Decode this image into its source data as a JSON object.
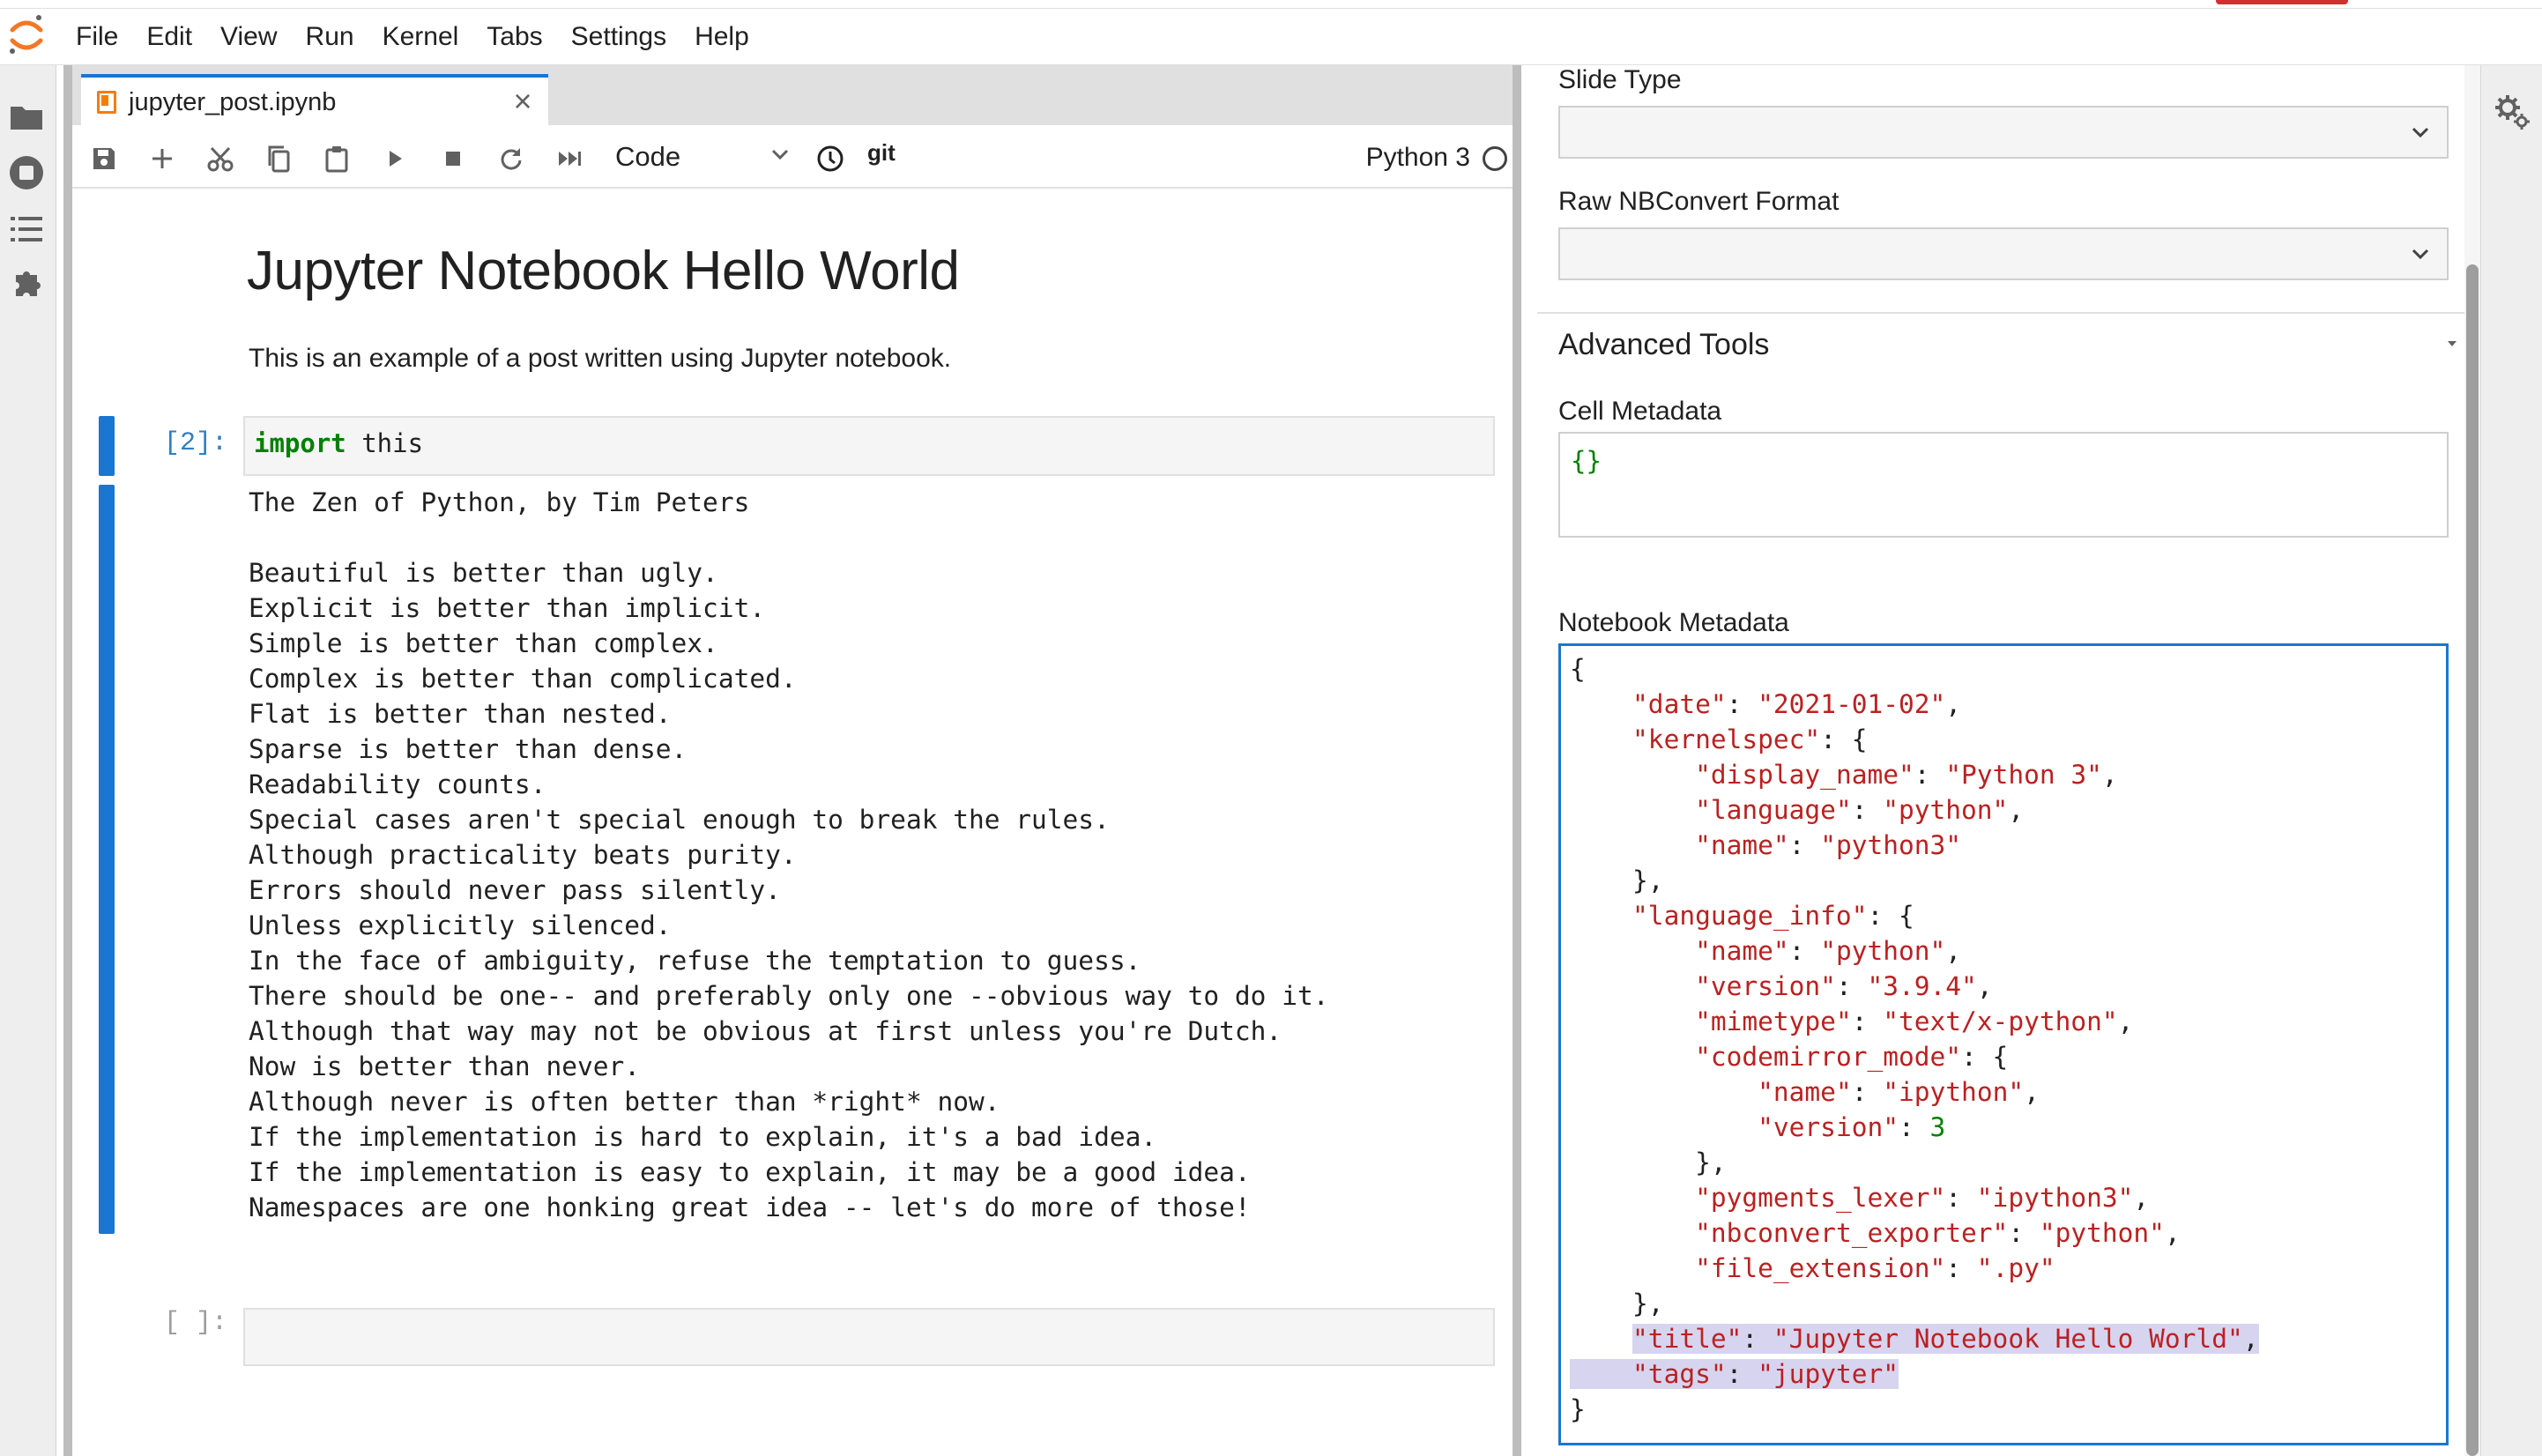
{
  "menubar": {
    "items": [
      "File",
      "Edit",
      "View",
      "Run",
      "Kernel",
      "Tabs",
      "Settings",
      "Help"
    ]
  },
  "left_sidebar": {
    "icons": [
      "folder-icon",
      "running-icon",
      "toc-icon",
      "extension-icon"
    ]
  },
  "notebook": {
    "tab_title": "jupyter_post.ipynb",
    "toolbar": {
      "buttons": [
        "save-icon",
        "add-icon",
        "cut-icon",
        "copy-icon",
        "paste-icon",
        "run-icon",
        "stop-icon",
        "restart-icon",
        "run-all-icon"
      ],
      "cell_type": "Code",
      "clock_icon": "clock-icon",
      "git_label": "git",
      "kernel_name": "Python 3"
    },
    "markdown": {
      "title": "Jupyter Notebook Hello World",
      "body": "This is an example of a post written using Jupyter notebook."
    },
    "code_cell": {
      "prompt": "[2]:",
      "keyword": "import",
      "rest": " this"
    },
    "output_lines": [
      "The Zen of Python, by Tim Peters",
      "",
      "Beautiful is better than ugly.",
      "Explicit is better than implicit.",
      "Simple is better than complex.",
      "Complex is better than complicated.",
      "Flat is better than nested.",
      "Sparse is better than dense.",
      "Readability counts.",
      "Special cases aren't special enough to break the rules.",
      "Although practicality beats purity.",
      "Errors should never pass silently.",
      "Unless explicitly silenced.",
      "In the face of ambiguity, refuse the temptation to guess.",
      "There should be one-- and preferably only one --obvious way to do it.",
      "Although that way may not be obvious at first unless you're Dutch.",
      "Now is better than never.",
      "Although never is often better than *right* now.",
      "If the implementation is hard to explain, it's a bad idea.",
      "If the implementation is easy to explain, it may be a good idea.",
      "Namespaces are one honking great idea -- let's do more of those!"
    ],
    "empty_prompt": "[ ]:"
  },
  "inspector": {
    "slide_type_label": "Slide Type",
    "slide_type_value": "",
    "raw_format_label": "Raw NBConvert Format",
    "raw_format_value": "",
    "advanced_tools_label": "Advanced Tools",
    "cell_metadata_label": "Cell Metadata",
    "cell_metadata_value": "{}",
    "notebook_metadata_label": "Notebook Metadata",
    "notebook_metadata_lines": [
      [
        [
          "p",
          "{"
        ]
      ],
      [
        [
          "p",
          "    "
        ],
        [
          "s",
          "\"date\""
        ],
        [
          "p",
          ": "
        ],
        [
          "s",
          "\"2021-01-02\""
        ],
        [
          "p",
          ","
        ]
      ],
      [
        [
          "p",
          "    "
        ],
        [
          "s",
          "\"kernelspec\""
        ],
        [
          "p",
          ": {"
        ]
      ],
      [
        [
          "p",
          "        "
        ],
        [
          "s",
          "\"display_name\""
        ],
        [
          "p",
          ": "
        ],
        [
          "s",
          "\"Python 3\""
        ],
        [
          "p",
          ","
        ]
      ],
      [
        [
          "p",
          "        "
        ],
        [
          "s",
          "\"language\""
        ],
        [
          "p",
          ": "
        ],
        [
          "s",
          "\"python\""
        ],
        [
          "p",
          ","
        ]
      ],
      [
        [
          "p",
          "        "
        ],
        [
          "s",
          "\"name\""
        ],
        [
          "p",
          ": "
        ],
        [
          "s",
          "\"python3\""
        ]
      ],
      [
        [
          "p",
          "    },"
        ]
      ],
      [
        [
          "p",
          "    "
        ],
        [
          "s",
          "\"language_info\""
        ],
        [
          "p",
          ": {"
        ]
      ],
      [
        [
          "p",
          "        "
        ],
        [
          "s",
          "\"name\""
        ],
        [
          "p",
          ": "
        ],
        [
          "s",
          "\"python\""
        ],
        [
          "p",
          ","
        ]
      ],
      [
        [
          "p",
          "        "
        ],
        [
          "s",
          "\"version\""
        ],
        [
          "p",
          ": "
        ],
        [
          "s",
          "\"3.9.4\""
        ],
        [
          "p",
          ","
        ]
      ],
      [
        [
          "p",
          "        "
        ],
        [
          "s",
          "\"mimetype\""
        ],
        [
          "p",
          ": "
        ],
        [
          "s",
          "\"text/x-python\""
        ],
        [
          "p",
          ","
        ]
      ],
      [
        [
          "p",
          "        "
        ],
        [
          "s",
          "\"codemirror_mode\""
        ],
        [
          "p",
          ": {"
        ]
      ],
      [
        [
          "p",
          "            "
        ],
        [
          "s",
          "\"name\""
        ],
        [
          "p",
          ": "
        ],
        [
          "s",
          "\"ipython\""
        ],
        [
          "p",
          ","
        ]
      ],
      [
        [
          "p",
          "            "
        ],
        [
          "s",
          "\"version\""
        ],
        [
          "p",
          ": "
        ],
        [
          "n",
          "3"
        ]
      ],
      [
        [
          "p",
          "        },"
        ]
      ],
      [
        [
          "p",
          "        "
        ],
        [
          "s",
          "\"pygments_lexer\""
        ],
        [
          "p",
          ": "
        ],
        [
          "s",
          "\"ipython3\""
        ],
        [
          "p",
          ","
        ]
      ],
      [
        [
          "p",
          "        "
        ],
        [
          "s",
          "\"nbconvert_exporter\""
        ],
        [
          "p",
          ": "
        ],
        [
          "s",
          "\"python\""
        ],
        [
          "p",
          ","
        ]
      ],
      [
        [
          "p",
          "        "
        ],
        [
          "s",
          "\"file_extension\""
        ],
        [
          "p",
          ": "
        ],
        [
          "s",
          "\".py\""
        ]
      ],
      [
        [
          "p",
          "    },"
        ]
      ],
      [
        [
          "p",
          "    "
        ],
        [
          "s",
          "\"title\""
        ],
        [
          "p",
          ": "
        ],
        [
          "s",
          "\"Jupyter Notebook Hello World\""
        ],
        [
          "p",
          ","
        ]
      ],
      [
        [
          "p",
          "    "
        ],
        [
          "s",
          "\"tags\""
        ],
        [
          "p",
          ": "
        ],
        [
          "s",
          "\"jupyter\""
        ]
      ],
      [
        [
          "p",
          "}"
        ]
      ]
    ],
    "highlighted_lines": [
      19,
      20
    ]
  },
  "right_sidebar": {
    "icons": [
      "property-inspector-gears-icon"
    ]
  },
  "colors": {
    "accent": "#1976d2",
    "string": "#ba2121",
    "keyword": "#008000",
    "selection": "#d7d4f0",
    "notebook_icon": "#f57c00"
  }
}
